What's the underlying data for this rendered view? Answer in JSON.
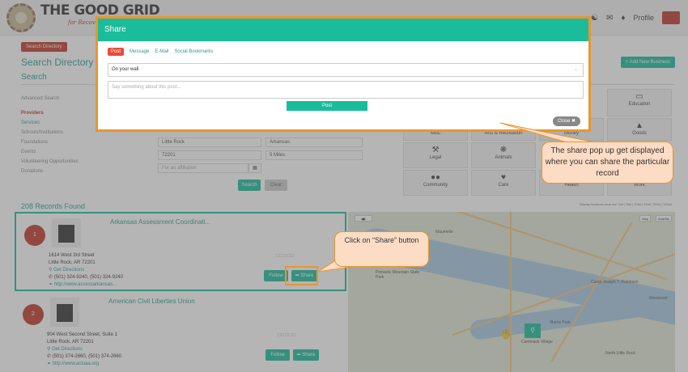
{
  "header": {
    "logo_main": "THE GOOD GRID",
    "logo_sub": "for Recovery",
    "profile_label": "Profile"
  },
  "page": {
    "directory_button": "Search Directory",
    "title": "Search Directory",
    "search_heading": "Search",
    "add_business": "+ Add New Business"
  },
  "sidebar": {
    "items": [
      "Advanced Search",
      "Providers",
      "Services",
      "Schools/Institutions",
      "Foundations",
      "Events",
      "Volunteering Opportunities",
      "Donations"
    ]
  },
  "search_form": {
    "city": "Little Rock",
    "state": "Arkansas",
    "zip": "72201",
    "distance": "5 Miles",
    "keyword_placeholder": "For an affiliation",
    "search_button": "Search",
    "clear_button": "Clear"
  },
  "categories": [
    {
      "label": "Education",
      "icon": "book-icon"
    },
    {
      "label": "Misc",
      "icon": "misc-icon"
    },
    {
      "label": "Arts & Recreation",
      "icon": "arts-icon"
    },
    {
      "label": "Money",
      "icon": "money-icon"
    },
    {
      "label": "Goods",
      "icon": "goods-icon"
    },
    {
      "label": "Legal",
      "icon": "gavel-icon"
    },
    {
      "label": "Animals",
      "icon": "paw-icon"
    },
    {
      "label": "Community",
      "icon": "people-icon"
    },
    {
      "label": "Care",
      "icon": "heart-icon"
    },
    {
      "label": "Health",
      "icon": "health-icon"
    },
    {
      "label": "Work",
      "icon": "work-icon"
    }
  ],
  "map_note": "Display locations near me: 1mi | 5mi | 10mi | 25mi | 50mi | 100mi",
  "records": {
    "count_label": "208 Records Found",
    "items": [
      {
        "num": "1",
        "name": "Arkansas Assessment Coordinati...",
        "address1": "1614 West 3rd Street",
        "address2": "Little Rock, AR 72201",
        "directions": "Get Directions",
        "phone": "(501) 324-9240, (501) 324-9240",
        "website": "http://www.accessarkansas...",
        "follow": "Follow",
        "share": "Share"
      },
      {
        "num": "2",
        "name": "American Civil Liberties Union",
        "address1": "904 West Second Street, Suite 1",
        "address2": "Little Rock, AR 72201",
        "directions": "Get Directions",
        "phone": "(501) 374-2660, (501) 374-2660",
        "website": "http://www.acluaa.org",
        "follow": "Follow",
        "share": "Share"
      }
    ]
  },
  "map": {
    "map_label": "Map",
    "satellite_label": "Satellite",
    "cities": [
      "Maumelle",
      "Pinnacle Mountain State Park",
      "North Little Rock",
      "Sherwood",
      "Camp Joseph T. Robinson",
      "Cammack Village",
      "Burns Park"
    ]
  },
  "modal": {
    "title": "Share",
    "tabs": [
      "Post",
      "Message",
      "E-Mail",
      "Social Bookmarks"
    ],
    "audience": "On your wall",
    "post_placeholder": "Say something about this post...",
    "post_button": "Post",
    "close_button": "Close"
  },
  "callouts": {
    "popup": "The share pop up get displayed where you can share the particular record",
    "share": "Click on “Share” button"
  },
  "colors": {
    "accent": "#1abc9c",
    "brand_red": "#c0392b",
    "callout_border": "#e8962e",
    "callout_fill": "#fcdcc4"
  }
}
